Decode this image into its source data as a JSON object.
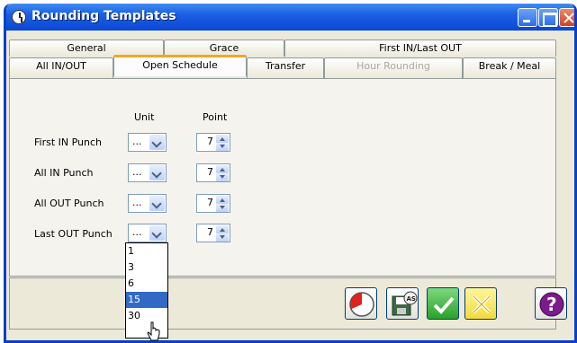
{
  "window": {
    "title": "Rounding Templates"
  },
  "tabs_row1": [
    "General",
    "Grace",
    "First IN/Last OUT"
  ],
  "tabs_row2": [
    "All IN/OUT",
    "Open Schedule",
    "Transfer",
    "Hour Rounding",
    "Break / Meal"
  ],
  "active_tab": "Open Schedule",
  "disabled_tab": "Hour Rounding",
  "columns": {
    "unit": "Unit",
    "point": "Point"
  },
  "rows": [
    {
      "label": "First IN Punch",
      "unit": "...",
      "point": "7"
    },
    {
      "label": "All IN Punch",
      "unit": "...",
      "point": "7"
    },
    {
      "label": "All OUT Punch",
      "unit": "...",
      "point": "7"
    },
    {
      "label": "Last OUT Punch",
      "unit": "...",
      "point": "7"
    }
  ],
  "dropdown": {
    "options": [
      "1",
      "3",
      "6",
      "15",
      "30"
    ],
    "highlighted": "15"
  },
  "buttons": [
    "clock-icon",
    "save-as-icon",
    "ok-check-icon",
    "cancel-x-icon",
    "help-icon"
  ],
  "colors": {
    "titlebar": "#0b48d4",
    "accent_tab": "#f5a623",
    "selection": "#316ac5"
  }
}
